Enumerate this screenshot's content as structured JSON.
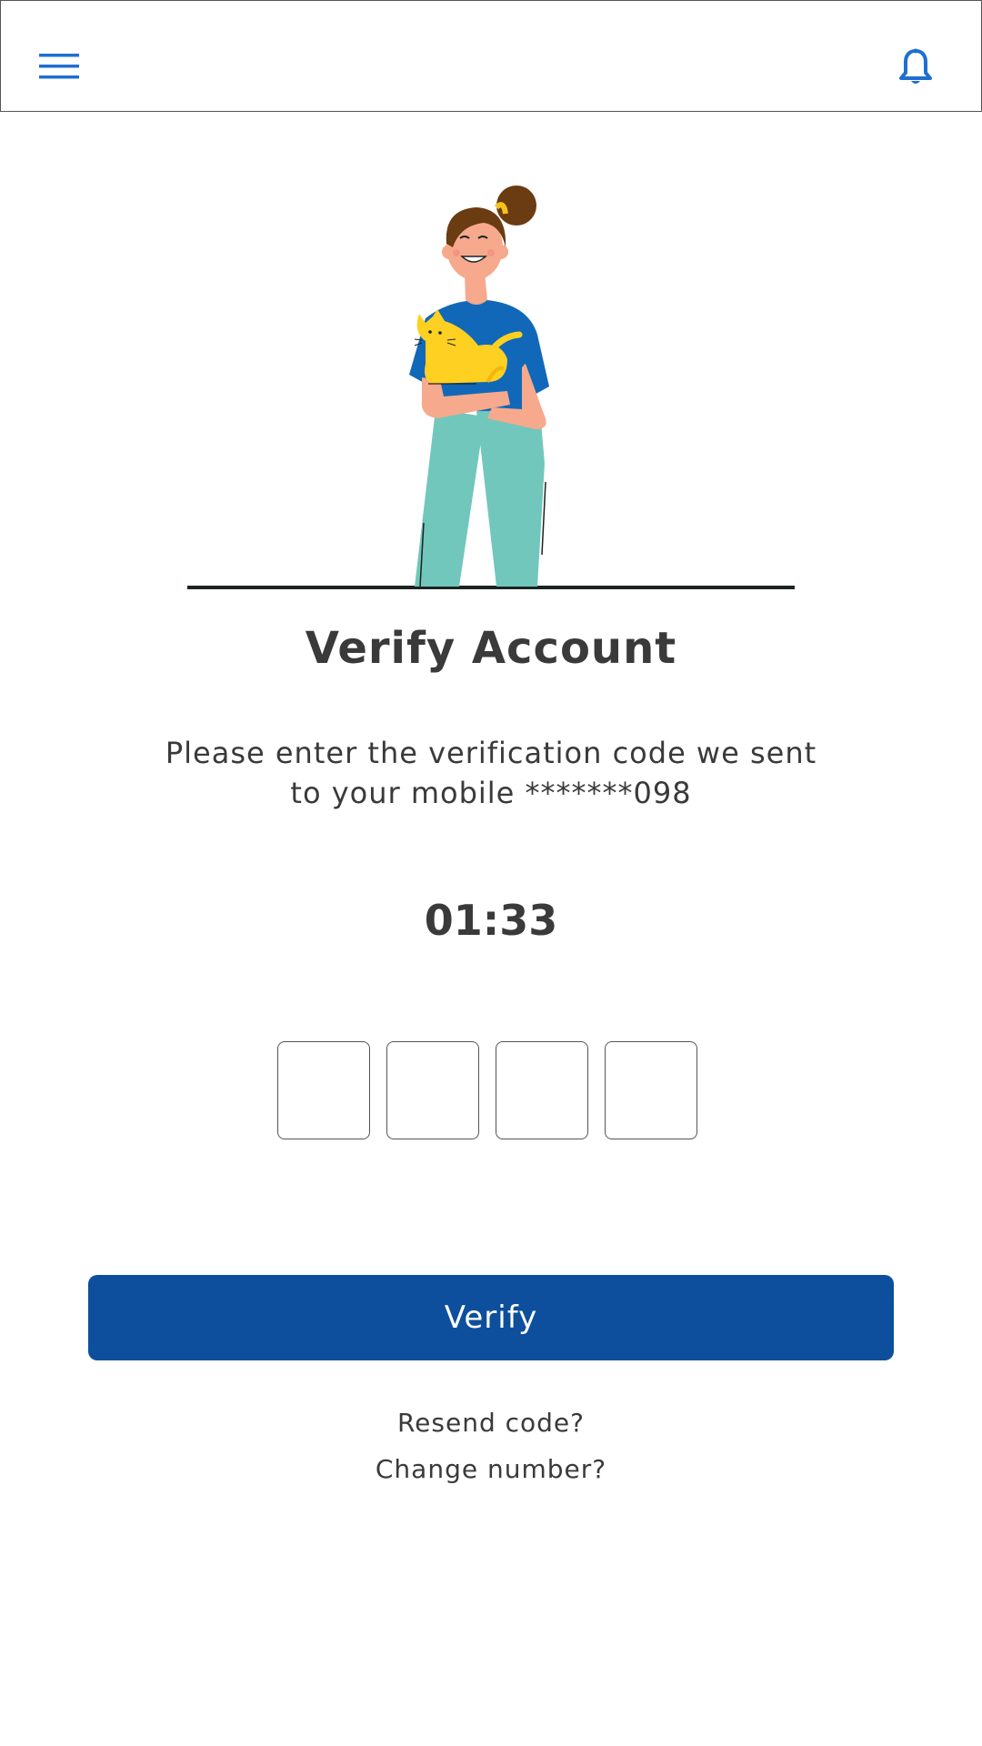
{
  "header": {
    "menu_icon": "hamburger-menu-icon",
    "notification_icon": "bell-icon",
    "accent_color": "#1f6fd1"
  },
  "illustration": {
    "description_icon": "woman-holding-cat-illustration"
  },
  "main": {
    "title": "Verify Account",
    "subtitle_line1": "Please enter the verification code we sent",
    "subtitle_line2": "to your mobile *******098",
    "timer": "01:33",
    "otp_fields": [
      {
        "value": ""
      },
      {
        "value": ""
      },
      {
        "value": ""
      },
      {
        "value": ""
      }
    ],
    "verify_label": "Verify",
    "verify_color": "#0d4f9c",
    "resend_label": "Resend code?",
    "change_number_label": "Change number?"
  }
}
